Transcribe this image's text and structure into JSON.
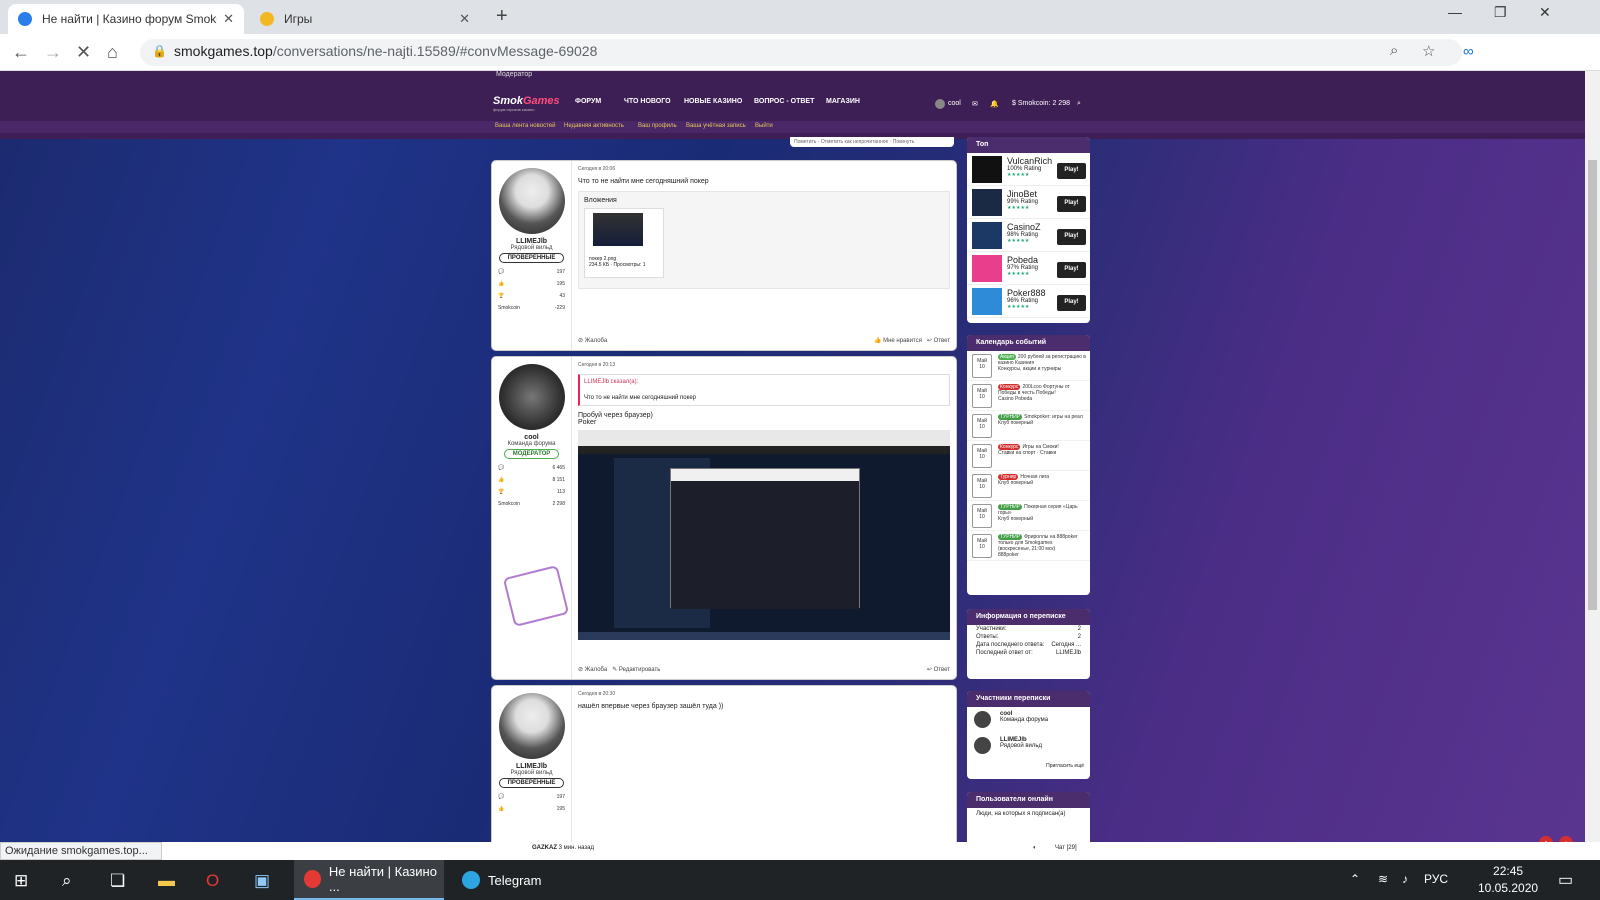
{
  "browser": {
    "tabs": [
      {
        "title": "Не найти | Казино форум SmokGames",
        "active": true,
        "favicon_color": "#2b7de9"
      },
      {
        "title": "Игры",
        "active": false,
        "favicon_color": "#f2b822"
      }
    ],
    "url_domain": "smokgames.top",
    "url_path": "/conversations/ne-najti.15589/#convMessage-69028",
    "status": "Ожидание smokgames.top..."
  },
  "site": {
    "moderator_link": "Модератор",
    "logo": {
      "a": "Smok",
      "b": "Games",
      "sub": "форум игроков казино"
    },
    "nav": [
      "ФОРУМ",
      "ЧТО НОВОГО",
      "НОВЫЕ КАЗИНО",
      "ВОПРОС - ОТВЕТ",
      "МАГАЗИН"
    ],
    "user": "cool",
    "balance": "Smokcoin: 2 298",
    "subnav": [
      "Ваша лента новостей",
      "Недавняя активность",
      "Ваш профиль",
      "Ваша учётная запись",
      "Выйти"
    ],
    "right_strip": "Пометить · Отметить как непрочитанное · Покинуть"
  },
  "messages": [
    {
      "user": "LLIMEJlb",
      "title": "Рядовой вильд",
      "badge": "ПРОВЕРЕННЫЕ",
      "stats": [
        "197",
        "195",
        "43"
      ],
      "smokcoin_label": "Smokcoin",
      "smokcoin": "-229",
      "date": "Сегодня в 20:06",
      "text": "Что то не найти мне сегодняшний покер",
      "attach_label": "Вложения",
      "file": "покер 2.png",
      "file_meta": "234.5 КБ · Просмотры: 1",
      "footer_left": "Жалоба",
      "footer_like": "Мне нравится",
      "footer_reply": "Ответ"
    },
    {
      "user": "cool",
      "title": "Команда форума",
      "badge": "МОДЕРАТОР",
      "stats": [
        "6 465",
        "8 151",
        "113"
      ],
      "smokcoin_label": "Smokcoin",
      "smokcoin": "2 298",
      "date": "Сегодня в 20:13",
      "quote_who": "LLIMEJlb сказал(а):",
      "quote_text": "Что то не найти мне сегодняшний покер",
      "text": "Пробуй через браузер)",
      "text2": "Poker",
      "footer_left": "Жалоба",
      "footer_edit": "Редактировать",
      "footer_reply": "Ответ"
    },
    {
      "user": "LLIMEJlb",
      "title": "Рядовой вильд",
      "badge": "ПРОВЕРЕННЫЕ",
      "stats": [
        "197",
        "195"
      ],
      "date": "Сегодня в 20:30",
      "text": "нашёл впервые через браузер зашёл туда ))"
    }
  ],
  "sidebar": {
    "top_title": "Топ",
    "casinos": [
      {
        "name": "VulcanRich",
        "rating": "100% Rating",
        "stars": "★★★★★",
        "play": "Play!",
        "color": "#111"
      },
      {
        "name": "JinoBet",
        "rating": "99% Rating",
        "stars": "★★★★★",
        "play": "Play!",
        "color": "#1b2a44"
      },
      {
        "name": "CasinoZ",
        "rating": "98% Rating",
        "stars": "★★★★★",
        "play": "Play!",
        "color": "#1c3864"
      },
      {
        "name": "Pobeda",
        "rating": "97% Rating",
        "stars": "★★★★★",
        "play": "Play!",
        "color": "#e83e8c"
      },
      {
        "name": "Poker888",
        "rating": "96% Rating",
        "stars": "★★★★★",
        "play": "Play!",
        "color": "#2e8bd8"
      }
    ],
    "calendar_title": "Календарь событий",
    "events": [
      {
        "month": "Май",
        "day": "10",
        "tag": "Акция",
        "tag_color": "#4caf50",
        "text": "200 рублей за регистрацию в казино Казиния",
        "sub": "Конкурсы, акции и турниры"
      },
      {
        "month": "Май",
        "day": "10",
        "tag": "Конкурс",
        "tag_color": "#d32f2f",
        "text": "200Lcoo Фортуны от Победы в честь Победы!",
        "sub": "Casino Pobeda"
      },
      {
        "month": "Май",
        "day": "10",
        "tag": "ТУРНИР",
        "tag_color": "#43a047",
        "text": "Smokpoker: игры на реал",
        "sub": "Клуб покерный"
      },
      {
        "month": "Май",
        "day": "10",
        "tag": "Конкурс",
        "tag_color": "#d32f2f",
        "text": "Игры на Смоки!",
        "sub": "Ставки на спорт · Ставки"
      },
      {
        "month": "Май",
        "day": "10",
        "tag": "Турнир",
        "tag_color": "#d32f2f",
        "text": "Ночная лига",
        "sub": "Клуб покерный"
      },
      {
        "month": "Май",
        "day": "10",
        "tag": "ТУРНИР",
        "tag_color": "#43a047",
        "text": "Покерная серия «Царь горы»",
        "sub": "Клуб покерный"
      },
      {
        "month": "Май",
        "day": "10",
        "tag": "ТУРНИР",
        "tag_color": "#43a047",
        "text": "Фрироллы на 888poker только для Smokgames (воскресенье, 21:00 мск)",
        "sub": "888poker"
      }
    ],
    "info_title": "Информация о переписке",
    "info": [
      [
        "Участники:",
        "2"
      ],
      [
        "Ответы:",
        "2"
      ],
      [
        "Дата последнего ответа:",
        "Сегодня ..."
      ],
      [
        "Последний ответ от:",
        "LLIMEJlb"
      ]
    ],
    "participants_title": "Участники переписки",
    "participants": [
      {
        "name": "cool",
        "title": "Команда форума"
      },
      {
        "name": "LLIMEJlb",
        "title": "Рядовой вильд"
      }
    ],
    "invite": "Пригласить ещё",
    "online_title": "Пользователи онлайн",
    "online_sub": "Люди, на которых я подписан(а)"
  },
  "chat": {
    "user": "GAZKAZ",
    "time": "3 мин. назад",
    "label": "Чат [29]"
  },
  "taskbar": {
    "apps": [
      {
        "label": "Не найти | Казино ...",
        "active": true
      },
      {
        "label": "Telegram",
        "active": false
      }
    ],
    "lang": "РУС",
    "time": "22:45",
    "date": "10.05.2020"
  }
}
